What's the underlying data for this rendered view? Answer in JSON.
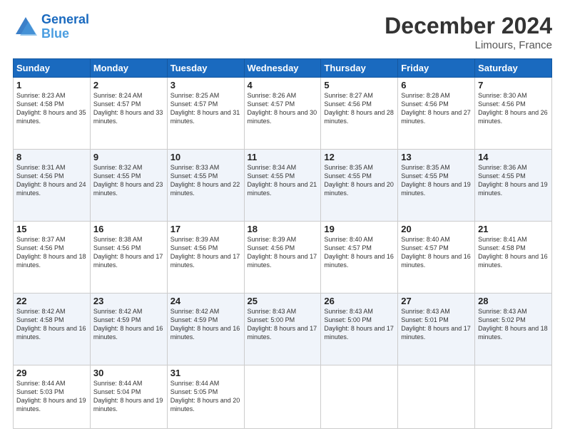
{
  "header": {
    "logo_line1": "General",
    "logo_line2": "Blue",
    "month": "December 2024",
    "location": "Limours, France"
  },
  "weekdays": [
    "Sunday",
    "Monday",
    "Tuesday",
    "Wednesday",
    "Thursday",
    "Friday",
    "Saturday"
  ],
  "weeks": [
    [
      {
        "day": "1",
        "sunrise": "8:23 AM",
        "sunset": "4:58 PM",
        "daylight": "8 hours and 35 minutes."
      },
      {
        "day": "2",
        "sunrise": "8:24 AM",
        "sunset": "4:57 PM",
        "daylight": "8 hours and 33 minutes."
      },
      {
        "day": "3",
        "sunrise": "8:25 AM",
        "sunset": "4:57 PM",
        "daylight": "8 hours and 31 minutes."
      },
      {
        "day": "4",
        "sunrise": "8:26 AM",
        "sunset": "4:57 PM",
        "daylight": "8 hours and 30 minutes."
      },
      {
        "day": "5",
        "sunrise": "8:27 AM",
        "sunset": "4:56 PM",
        "daylight": "8 hours and 28 minutes."
      },
      {
        "day": "6",
        "sunrise": "8:28 AM",
        "sunset": "4:56 PM",
        "daylight": "8 hours and 27 minutes."
      },
      {
        "day": "7",
        "sunrise": "8:30 AM",
        "sunset": "4:56 PM",
        "daylight": "8 hours and 26 minutes."
      }
    ],
    [
      {
        "day": "8",
        "sunrise": "8:31 AM",
        "sunset": "4:56 PM",
        "daylight": "8 hours and 24 minutes."
      },
      {
        "day": "9",
        "sunrise": "8:32 AM",
        "sunset": "4:55 PM",
        "daylight": "8 hours and 23 minutes."
      },
      {
        "day": "10",
        "sunrise": "8:33 AM",
        "sunset": "4:55 PM",
        "daylight": "8 hours and 22 minutes."
      },
      {
        "day": "11",
        "sunrise": "8:34 AM",
        "sunset": "4:55 PM",
        "daylight": "8 hours and 21 minutes."
      },
      {
        "day": "12",
        "sunrise": "8:35 AM",
        "sunset": "4:55 PM",
        "daylight": "8 hours and 20 minutes."
      },
      {
        "day": "13",
        "sunrise": "8:35 AM",
        "sunset": "4:55 PM",
        "daylight": "8 hours and 19 minutes."
      },
      {
        "day": "14",
        "sunrise": "8:36 AM",
        "sunset": "4:55 PM",
        "daylight": "8 hours and 19 minutes."
      }
    ],
    [
      {
        "day": "15",
        "sunrise": "8:37 AM",
        "sunset": "4:56 PM",
        "daylight": "8 hours and 18 minutes."
      },
      {
        "day": "16",
        "sunrise": "8:38 AM",
        "sunset": "4:56 PM",
        "daylight": "8 hours and 17 minutes."
      },
      {
        "day": "17",
        "sunrise": "8:39 AM",
        "sunset": "4:56 PM",
        "daylight": "8 hours and 17 minutes."
      },
      {
        "day": "18",
        "sunrise": "8:39 AM",
        "sunset": "4:56 PM",
        "daylight": "8 hours and 17 minutes."
      },
      {
        "day": "19",
        "sunrise": "8:40 AM",
        "sunset": "4:57 PM",
        "daylight": "8 hours and 16 minutes."
      },
      {
        "day": "20",
        "sunrise": "8:40 AM",
        "sunset": "4:57 PM",
        "daylight": "8 hours and 16 minutes."
      },
      {
        "day": "21",
        "sunrise": "8:41 AM",
        "sunset": "4:58 PM",
        "daylight": "8 hours and 16 minutes."
      }
    ],
    [
      {
        "day": "22",
        "sunrise": "8:42 AM",
        "sunset": "4:58 PM",
        "daylight": "8 hours and 16 minutes."
      },
      {
        "day": "23",
        "sunrise": "8:42 AM",
        "sunset": "4:59 PM",
        "daylight": "8 hours and 16 minutes."
      },
      {
        "day": "24",
        "sunrise": "8:42 AM",
        "sunset": "4:59 PM",
        "daylight": "8 hours and 16 minutes."
      },
      {
        "day": "25",
        "sunrise": "8:43 AM",
        "sunset": "5:00 PM",
        "daylight": "8 hours and 17 minutes."
      },
      {
        "day": "26",
        "sunrise": "8:43 AM",
        "sunset": "5:00 PM",
        "daylight": "8 hours and 17 minutes."
      },
      {
        "day": "27",
        "sunrise": "8:43 AM",
        "sunset": "5:01 PM",
        "daylight": "8 hours and 17 minutes."
      },
      {
        "day": "28",
        "sunrise": "8:43 AM",
        "sunset": "5:02 PM",
        "daylight": "8 hours and 18 minutes."
      }
    ],
    [
      {
        "day": "29",
        "sunrise": "8:44 AM",
        "sunset": "5:03 PM",
        "daylight": "8 hours and 19 minutes."
      },
      {
        "day": "30",
        "sunrise": "8:44 AM",
        "sunset": "5:04 PM",
        "daylight": "8 hours and 19 minutes."
      },
      {
        "day": "31",
        "sunrise": "8:44 AM",
        "sunset": "5:05 PM",
        "daylight": "8 hours and 20 minutes."
      },
      null,
      null,
      null,
      null
    ]
  ]
}
